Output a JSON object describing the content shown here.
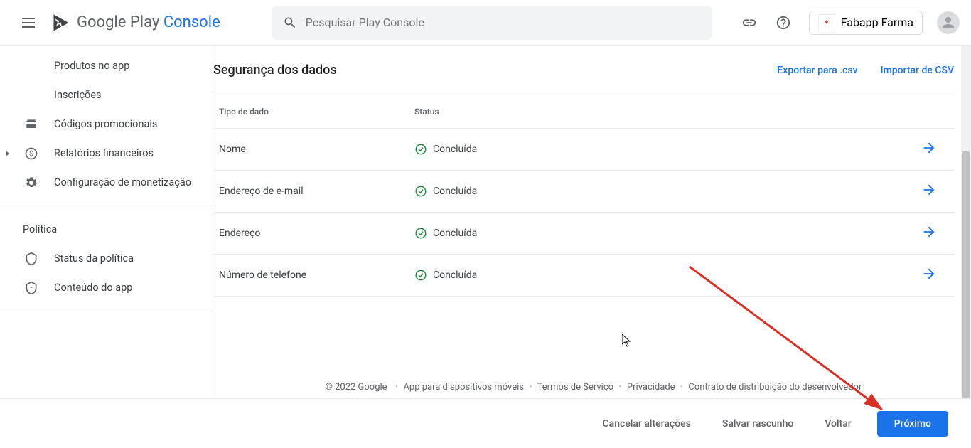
{
  "header": {
    "brand_a": "Google Play ",
    "brand_b": "Console",
    "search_placeholder": "Pesquisar Play Console",
    "user_name": "Fabapp Farma"
  },
  "sidebar": {
    "items": [
      {
        "label": "Produtos no app"
      },
      {
        "label": "Inscrições"
      },
      {
        "label": "Códigos promocionais"
      },
      {
        "label": "Relatórios financeiros"
      },
      {
        "label": "Configuração de monetização"
      }
    ],
    "group": "Política",
    "group_items": [
      {
        "label": "Status da política"
      },
      {
        "label": "Conteúdo do app"
      }
    ]
  },
  "main": {
    "title": "Segurança dos dados",
    "export_label": "Exportar para .csv",
    "import_label": "Importar de CSV",
    "col_type": "Tipo de dado",
    "col_status": "Status",
    "rows": [
      {
        "type": "Nome",
        "status": "Concluída"
      },
      {
        "type": "Endereço de e-mail",
        "status": "Concluída"
      },
      {
        "type": "Endereço",
        "status": "Concluída"
      },
      {
        "type": "Número de telefone",
        "status": "Concluída"
      }
    ]
  },
  "footer": {
    "copyright": "© 2022 Google",
    "link1": "App para dispositivos móveis",
    "link2": "Termos de Serviço",
    "link3": "Privacidade",
    "link4": "Contrato de distribuição do desenvolvedor"
  },
  "bottombar": {
    "cancel": "Cancelar alterações",
    "draft": "Salvar rascunho",
    "back": "Voltar",
    "next": "Próximo"
  }
}
